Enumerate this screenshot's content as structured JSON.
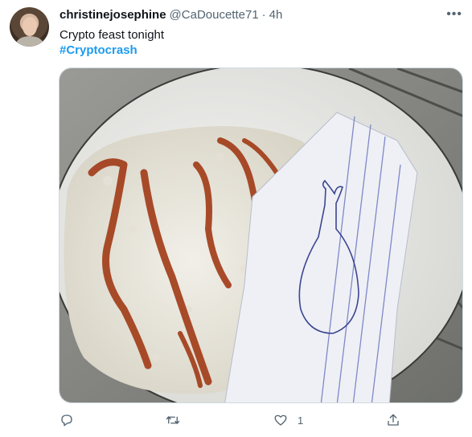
{
  "tweet": {
    "display_name": "christinejosephine",
    "handle": "@CaDoucette71",
    "separator": "·",
    "time": "4h",
    "text": "Crypto feast tonight",
    "hashtag": "#Cryptocrash",
    "more_icon": "more-horizontal-icon"
  },
  "actions": {
    "reply_icon": "reply-icon",
    "retweet_icon": "retweet-icon",
    "like_icon": "heart-icon",
    "like_count": "1",
    "share_icon": "share-icon"
  },
  "colors": {
    "text": "#0f1419",
    "secondary": "#536471",
    "link": "#1d9bf0",
    "border": "#cfd9de"
  }
}
